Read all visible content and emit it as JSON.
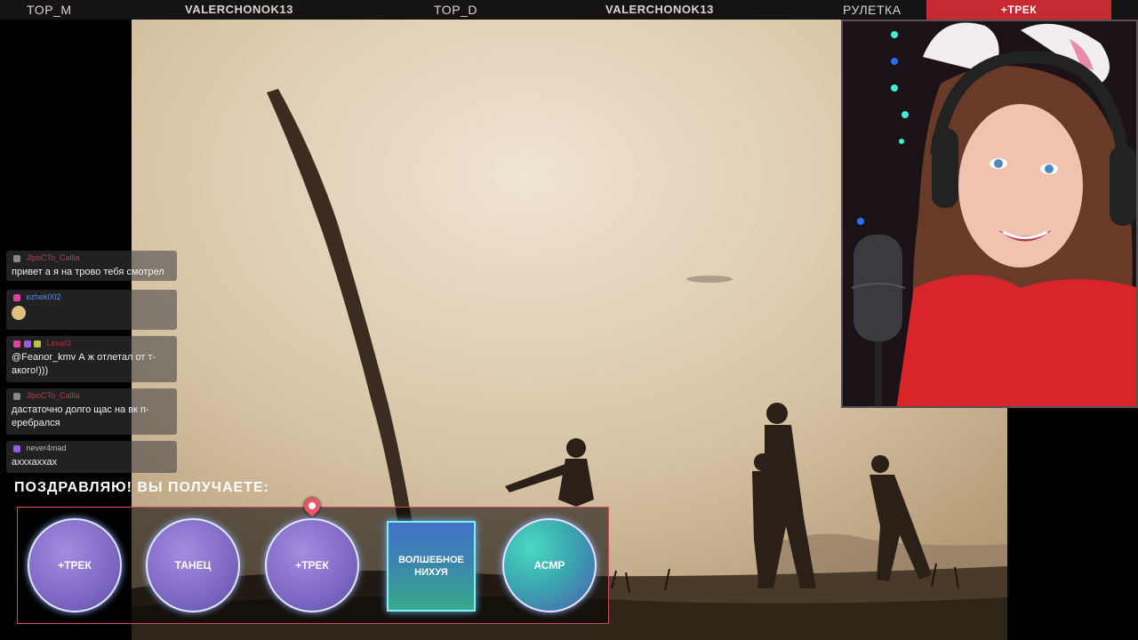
{
  "topbar": {
    "items": [
      {
        "label": "TOP_M"
      },
      {
        "label": "VALERCHONOK13"
      },
      {
        "label": "TOP_D"
      },
      {
        "label": "VALERCHONOK13"
      },
      {
        "label": "РУЛЕТКА"
      },
      {
        "label": "+ТРЕК"
      }
    ]
  },
  "chat": {
    "messages": [
      {
        "user": "JlpoCTo_Callla",
        "text": "привет а я на трово тебя смотрел"
      },
      {
        "user": "ezhek002",
        "text": ""
      },
      {
        "user": "Lexat3",
        "text": "@Feanor_kmv А ж отлетал от т-акого!)))"
      },
      {
        "user": "JlpoCTo_Callla",
        "text": "дастаточно долго щас на вк п-еребрался"
      },
      {
        "user": "never4mad",
        "text": "ахххаххах"
      }
    ]
  },
  "reward": {
    "title": "ПОЗДРАВЛЯЮ! ВЫ ПОЛУЧАЕТЕ:",
    "options": [
      {
        "label": "+ТРЕК"
      },
      {
        "label": "ТАНЕЦ"
      },
      {
        "label": "+ТРЕК"
      },
      {
        "label": "ВОЛШЕБНОЕ НИХУЯ"
      },
      {
        "label": "АСМР"
      }
    ]
  },
  "colors": {
    "accent_red": "#c42a30",
    "topbar_bg": "#151313",
    "reward_border": "#d04a6a"
  }
}
